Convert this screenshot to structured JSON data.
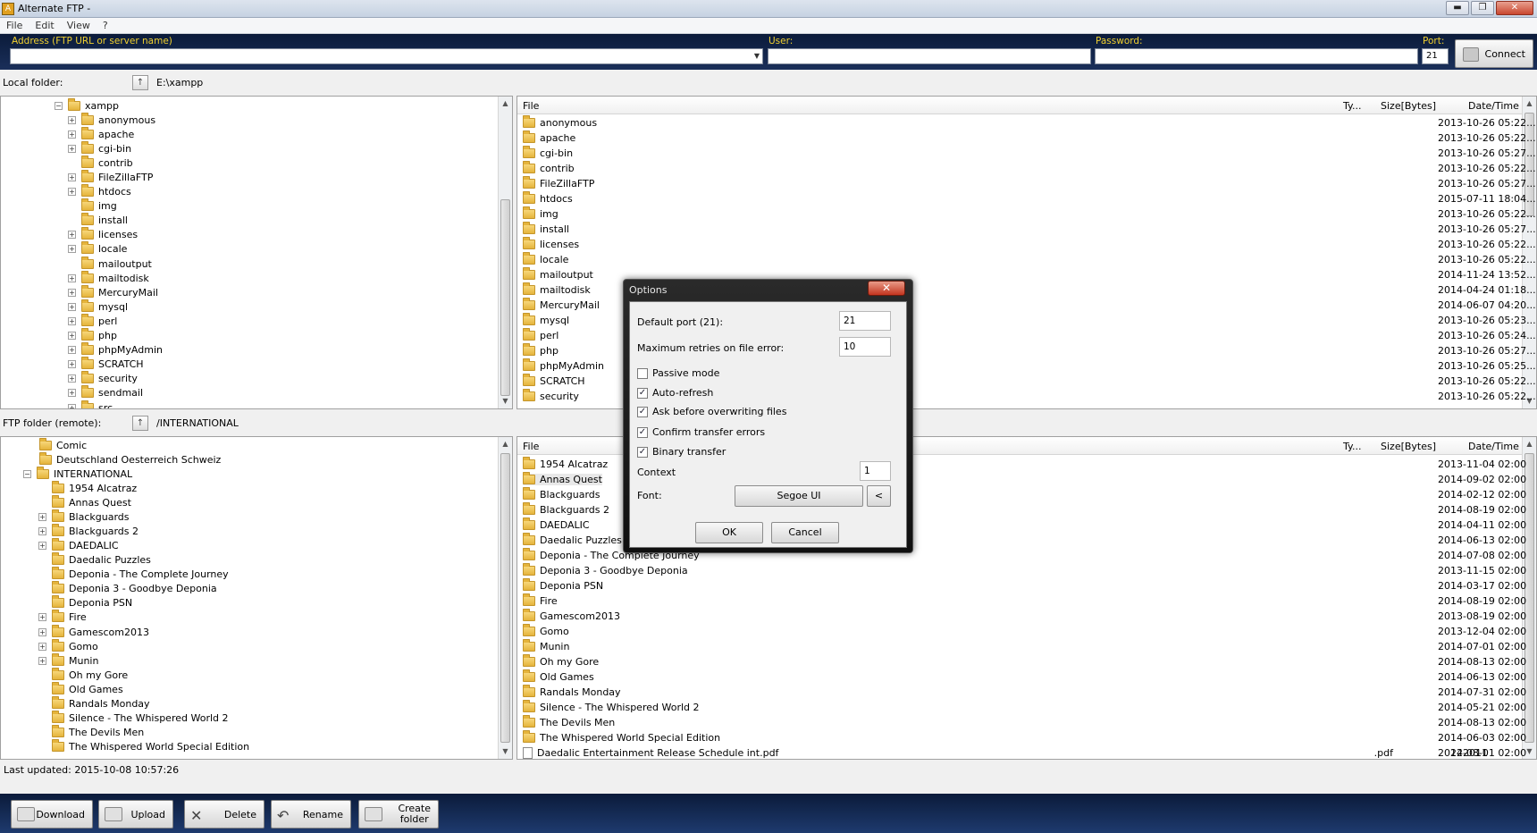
{
  "window": {
    "title": "Alternate FTP -",
    "minimize": "▬",
    "maximize": "❐",
    "close": "✕"
  },
  "menu": [
    "File",
    "Edit",
    "View",
    "?"
  ],
  "address": {
    "address_label": "Address (FTP URL or server name)",
    "address_value": "",
    "user_label": "User:",
    "user_value": "",
    "password_label": "Password:",
    "password_value": "",
    "port_label": "Port:",
    "port_value": "21",
    "connect_label": "Connect"
  },
  "local": {
    "label": "Local folder:",
    "path": "E:\\xampp",
    "tree_root": "xampp",
    "tree": [
      {
        "name": "anonymous",
        "exp": true
      },
      {
        "name": "apache",
        "exp": true
      },
      {
        "name": "cgi-bin",
        "exp": true
      },
      {
        "name": "contrib",
        "exp": false
      },
      {
        "name": "FileZillaFTP",
        "exp": true
      },
      {
        "name": "htdocs",
        "exp": true
      },
      {
        "name": "img",
        "exp": false
      },
      {
        "name": "install",
        "exp": false
      },
      {
        "name": "licenses",
        "exp": true
      },
      {
        "name": "locale",
        "exp": true
      },
      {
        "name": "mailoutput",
        "exp": false
      },
      {
        "name": "mailtodisk",
        "exp": true
      },
      {
        "name": "MercuryMail",
        "exp": true
      },
      {
        "name": "mysql",
        "exp": true
      },
      {
        "name": "perl",
        "exp": true
      },
      {
        "name": "php",
        "exp": true
      },
      {
        "name": "phpMyAdmin",
        "exp": true
      },
      {
        "name": "SCRATCH",
        "exp": true
      },
      {
        "name": "security",
        "exp": true
      },
      {
        "name": "sendmail",
        "exp": true
      },
      {
        "name": "src",
        "exp": true
      }
    ],
    "columns": {
      "file": "File",
      "type": "Ty...",
      "size": "Size[Bytes]",
      "date": "Date/Time"
    },
    "files": [
      {
        "name": "anonymous",
        "type": "",
        "size": "",
        "date": "2013-10-26 05:22..."
      },
      {
        "name": "apache",
        "type": "",
        "size": "",
        "date": "2013-10-26 05:22..."
      },
      {
        "name": "cgi-bin",
        "type": "",
        "size": "",
        "date": "2013-10-26 05:27..."
      },
      {
        "name": "contrib",
        "type": "",
        "size": "",
        "date": "2013-10-26 05:22..."
      },
      {
        "name": "FileZillaFTP",
        "type": "",
        "size": "",
        "date": "2013-10-26 05:27..."
      },
      {
        "name": "htdocs",
        "type": "",
        "size": "",
        "date": "2015-07-11 18:04..."
      },
      {
        "name": "img",
        "type": "",
        "size": "",
        "date": "2013-10-26 05:22..."
      },
      {
        "name": "install",
        "type": "",
        "size": "",
        "date": "2013-10-26 05:27..."
      },
      {
        "name": "licenses",
        "type": "",
        "size": "",
        "date": "2013-10-26 05:22..."
      },
      {
        "name": "locale",
        "type": "",
        "size": "",
        "date": "2013-10-26 05:22..."
      },
      {
        "name": "mailoutput",
        "type": "",
        "size": "",
        "date": "2014-11-24 13:52..."
      },
      {
        "name": "mailtodisk",
        "type": "",
        "size": "",
        "date": "2014-04-24 01:18..."
      },
      {
        "name": "MercuryMail",
        "type": "",
        "size": "",
        "date": "2014-06-07 04:20..."
      },
      {
        "name": "mysql",
        "type": "",
        "size": "",
        "date": "2013-10-26 05:23..."
      },
      {
        "name": "perl",
        "type": "",
        "size": "",
        "date": "2013-10-26 05:24..."
      },
      {
        "name": "php",
        "type": "",
        "size": "",
        "date": "2013-10-26 05:27..."
      },
      {
        "name": "phpMyAdmin",
        "type": "",
        "size": "",
        "date": "2013-10-26 05:25..."
      },
      {
        "name": "SCRATCH",
        "type": "",
        "size": "",
        "date": "2013-10-26 05:22..."
      },
      {
        "name": "security",
        "type": "",
        "size": "",
        "date": "2013-10-26 05:22..."
      }
    ]
  },
  "remote": {
    "label": "FTP folder (remote):",
    "path": "/INTERNATIONAL",
    "tree_top": [
      {
        "name": "Comic"
      },
      {
        "name": "Deutschland Oesterreich Schweiz"
      }
    ],
    "tree_root": "INTERNATIONAL",
    "tree": [
      {
        "name": "1954 Alcatraz",
        "exp": false
      },
      {
        "name": "Annas Quest",
        "exp": false
      },
      {
        "name": "Blackguards",
        "exp": true
      },
      {
        "name": "Blackguards 2",
        "exp": true
      },
      {
        "name": "DAEDALIC",
        "exp": true
      },
      {
        "name": "Daedalic Puzzles",
        "exp": false
      },
      {
        "name": "Deponia - The Complete Journey",
        "exp": false
      },
      {
        "name": "Deponia 3 - Goodbye Deponia",
        "exp": false
      },
      {
        "name": "Deponia PSN",
        "exp": false
      },
      {
        "name": "Fire",
        "exp": true
      },
      {
        "name": "Gamescom2013",
        "exp": true
      },
      {
        "name": "Gomo",
        "exp": true
      },
      {
        "name": "Munin",
        "exp": true
      },
      {
        "name": "Oh my Gore",
        "exp": false
      },
      {
        "name": "Old Games",
        "exp": false
      },
      {
        "name": "Randals Monday",
        "exp": false
      },
      {
        "name": "Silence - The Whispered World 2",
        "exp": false
      },
      {
        "name": "The Devils Men",
        "exp": false
      },
      {
        "name": "The Whispered World Special Edition",
        "exp": false
      }
    ],
    "columns": {
      "file": "File",
      "type": "Ty...",
      "size": "Size[Bytes]",
      "date": "Date/Time"
    },
    "files": [
      {
        "name": "1954 Alcatraz",
        "type": "",
        "size": "",
        "date": "2013-11-04 02:00",
        "kind": "folder"
      },
      {
        "name": "Annas Quest",
        "type": "",
        "size": "",
        "date": "2014-09-02 02:00",
        "kind": "folder"
      },
      {
        "name": "Blackguards",
        "type": "",
        "size": "",
        "date": "2014-02-12 02:00",
        "kind": "folder"
      },
      {
        "name": "Blackguards 2",
        "type": "",
        "size": "",
        "date": "2014-08-19 02:00",
        "kind": "folder"
      },
      {
        "name": "DAEDALIC",
        "type": "",
        "size": "",
        "date": "2014-04-11 02:00",
        "kind": "folder"
      },
      {
        "name": "Daedalic Puzzles",
        "type": "",
        "size": "",
        "date": "2014-06-13 02:00",
        "kind": "folder"
      },
      {
        "name": "Deponia - The Complete Journey",
        "type": "",
        "size": "",
        "date": "2014-07-08 02:00",
        "kind": "folder"
      },
      {
        "name": "Deponia 3 - Goodbye Deponia",
        "type": "",
        "size": "",
        "date": "2013-11-15 02:00",
        "kind": "folder"
      },
      {
        "name": "Deponia PSN",
        "type": "",
        "size": "",
        "date": "2014-03-17 02:00",
        "kind": "folder"
      },
      {
        "name": "Fire",
        "type": "",
        "size": "",
        "date": "2014-08-19 02:00",
        "kind": "folder"
      },
      {
        "name": "Gamescom2013",
        "type": "",
        "size": "",
        "date": "2013-08-19 02:00",
        "kind": "folder"
      },
      {
        "name": "Gomo",
        "type": "",
        "size": "",
        "date": "2013-12-04 02:00",
        "kind": "folder"
      },
      {
        "name": "Munin",
        "type": "",
        "size": "",
        "date": "2014-07-01 02:00",
        "kind": "folder"
      },
      {
        "name": "Oh my Gore",
        "type": "",
        "size": "",
        "date": "2014-08-13 02:00",
        "kind": "folder"
      },
      {
        "name": "Old Games",
        "type": "",
        "size": "",
        "date": "2014-06-13 02:00",
        "kind": "folder"
      },
      {
        "name": "Randals Monday",
        "type": "",
        "size": "",
        "date": "2014-07-31 02:00",
        "kind": "folder"
      },
      {
        "name": "Silence - The Whispered World 2",
        "type": "",
        "size": "",
        "date": "2014-05-21 02:00",
        "kind": "folder"
      },
      {
        "name": "The Devils Men",
        "type": "",
        "size": "",
        "date": "2014-08-13 02:00",
        "kind": "folder"
      },
      {
        "name": "The Whispered World Special Edition",
        "type": "",
        "size": "",
        "date": "2014-06-03 02:00",
        "kind": "folder"
      },
      {
        "name": "Daedalic Entertainment Release Schedule int.pdf",
        "type": ".pdf",
        "size": "222011",
        "date": "2014-08-01 02:00",
        "kind": "file"
      }
    ]
  },
  "status": {
    "text": "Last updated: 2015-10-08 10:57:26"
  },
  "toolbar": {
    "download": "Download",
    "upload": "Upload",
    "delete": "Delete",
    "rename": "Rename",
    "create1": "Create",
    "create2": "folder"
  },
  "options": {
    "title": "Options",
    "close": "✕",
    "default_port_label": "Default port (21):",
    "default_port_value": "21",
    "max_retries_label": "Maximum retries on file error:",
    "max_retries_value": "10",
    "passive_label": "Passive mode",
    "passive_checked": false,
    "autorefresh_label": "Auto-refresh",
    "autorefresh_checked": true,
    "askoverwrite_label": "Ask before overwriting files",
    "askoverwrite_checked": true,
    "confirmerrors_label": "Confirm transfer errors",
    "confirmerrors_checked": true,
    "binary_label": "Binary transfer",
    "binary_checked": true,
    "context_label": "Context",
    "context_value": "1",
    "font_label": "Font:",
    "font_value": "Segoe UI",
    "font_btn": "<",
    "ok": "OK",
    "cancel": "Cancel"
  }
}
